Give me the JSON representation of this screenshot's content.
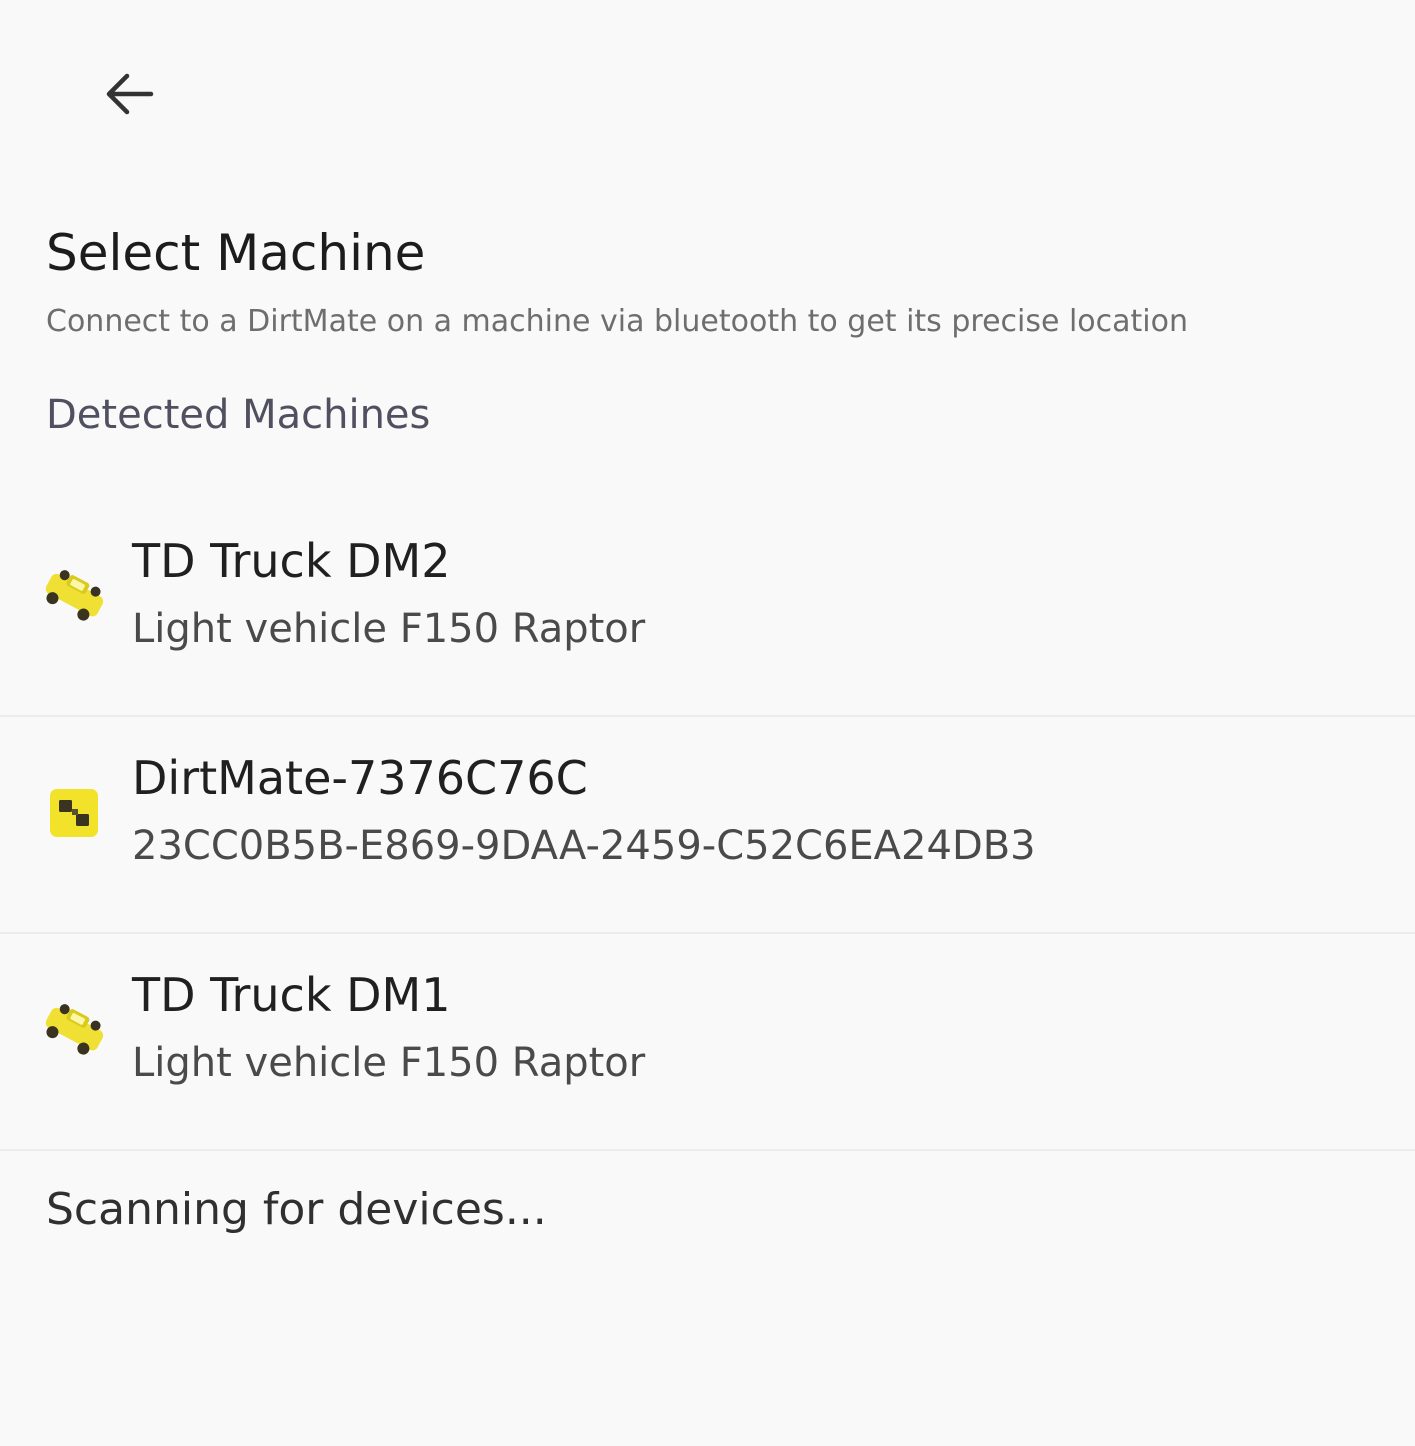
{
  "header": {
    "back_icon": "arrow-left-icon"
  },
  "title": "Select Machine",
  "subtitle": "Connect to a DirtMate on a machine via bluetooth to get its precise location",
  "section_label": "Detected Machines",
  "machines": [
    {
      "name": "TD Truck DM2",
      "description": "Light vehicle F150 Raptor",
      "icon": "truck-icon"
    },
    {
      "name": "DirtMate-7376C76C",
      "description": "23CC0B5B-E869-9DAA-2459-C52C6EA24DB3",
      "icon": "dirtmate-device-icon"
    },
    {
      "name": "TD Truck DM1",
      "description": "Light vehicle F150 Raptor",
      "icon": "truck-icon"
    }
  ],
  "status": "Scanning for devices...",
  "colors": {
    "background": "#f9f9f9",
    "accent_yellow": "#f2e22a",
    "divider": "#ececec"
  }
}
